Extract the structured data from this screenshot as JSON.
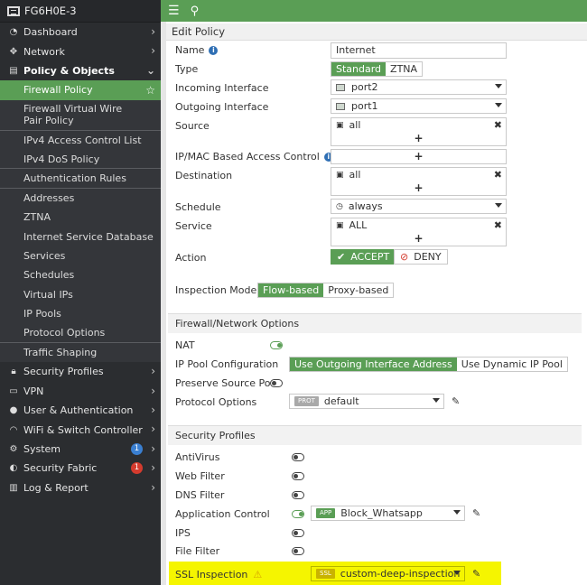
{
  "device_name": "FG6H0E-3",
  "nav": {
    "dashboard": "Dashboard",
    "network": "Network",
    "policy_objects": "Policy & Objects",
    "policy_children": [
      "Firewall Policy",
      "Firewall Virtual Wire Pair Policy",
      "IPv4 Access Control List",
      "IPv4 DoS Policy",
      "Authentication Rules",
      "Addresses",
      "ZTNA",
      "Internet Service Database",
      "Services",
      "Schedules",
      "Virtual IPs",
      "IP Pools",
      "Protocol Options",
      "Traffic Shaping"
    ],
    "security_profiles": "Security Profiles",
    "vpn": "VPN",
    "user_auth": "User & Authentication",
    "wifi_switch": "WiFi & Switch Controller",
    "system": "System",
    "system_badge": "1",
    "security_fabric": "Security Fabric",
    "security_fabric_badge": "1",
    "log_report": "Log & Report"
  },
  "header": {
    "title": "Edit Policy"
  },
  "form": {
    "name_label": "Name",
    "name_value": "Internet",
    "type_label": "Type",
    "type_options": [
      "Standard",
      "ZTNA"
    ],
    "incoming_label": "Incoming Interface",
    "incoming_value": "port2",
    "outgoing_label": "Outgoing Interface",
    "outgoing_value": "port1",
    "source_label": "Source",
    "source_value": "all",
    "ipmac_label": "IP/MAC Based Access Control",
    "destination_label": "Destination",
    "destination_value": "all",
    "schedule_label": "Schedule",
    "schedule_value": "always",
    "service_label": "Service",
    "service_value": "ALL",
    "action_label": "Action",
    "action_accept": "ACCEPT",
    "action_deny": "DENY",
    "inspection_label": "Inspection Mode",
    "inspection_options": [
      "Flow-based",
      "Proxy-based"
    ]
  },
  "fw_section": {
    "title": "Firewall/Network Options",
    "nat_label": "NAT",
    "ippool_label": "IP Pool Configuration",
    "ippool_options": [
      "Use Outgoing Interface Address",
      "Use Dynamic IP Pool"
    ],
    "preserve_label": "Preserve Source Port",
    "protocol_label": "Protocol Options",
    "protocol_tag": "PROT",
    "protocol_value": "default"
  },
  "sec_section": {
    "title": "Security Profiles",
    "antivirus": "AntiVirus",
    "webfilter": "Web Filter",
    "dnsfilter": "DNS Filter",
    "appcontrol": "Application Control",
    "app_tag": "APP",
    "app_value": "Block_Whatsapp",
    "ips": "IPS",
    "filefilter": "File Filter",
    "ssl_label": "SSL Inspection",
    "ssl_tag": "SSL",
    "ssl_value": "custom-deep-inspection"
  },
  "colors": {
    "accent": "#5a9e55",
    "sidebar": "#2b2d30",
    "highlight": "#f5f500"
  },
  "icons": [
    "menu-icon",
    "search-icon",
    "info-icon",
    "checkmark-icon",
    "deny-icon",
    "pencil-icon",
    "warning-icon",
    "star-icon"
  ]
}
